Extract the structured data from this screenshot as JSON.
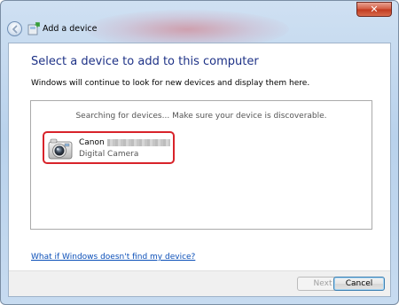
{
  "window": {
    "title": "Add a device",
    "close_glyph": "✕"
  },
  "page": {
    "heading": "Select a device to add to this computer",
    "subtext": "Windows will continue to look for new devices and display them here.",
    "search_status": "Searching for devices...  Make sure your device is discoverable.",
    "help_link": "What if Windows doesn't find my device?"
  },
  "devices": [
    {
      "name": "Canon",
      "type": "Digital Camera",
      "icon": "camera-icon",
      "highlight_color": "#d8232a"
    }
  ],
  "buttons": {
    "next": "Next",
    "cancel": "Cancel"
  },
  "colors": {
    "heading": "#1e3287",
    "link": "#0b4fb8",
    "selection_outline": "#d8232a"
  }
}
